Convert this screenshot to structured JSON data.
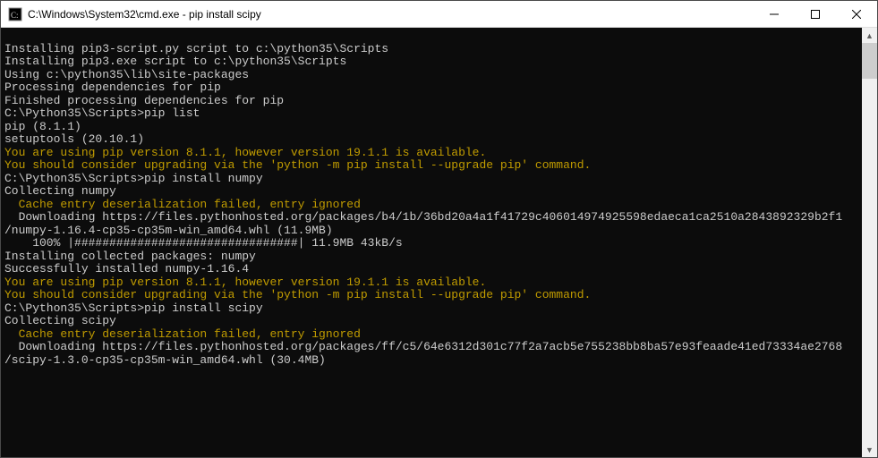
{
  "window": {
    "title": "C:\\Windows\\System32\\cmd.exe - pip  install scipy"
  },
  "lines": {
    "l1": "Installing pip3-script.py script to c:\\python35\\Scripts",
    "l2": "Installing pip3.exe script to c:\\python35\\Scripts",
    "l3": "",
    "l4": "Using c:\\python35\\lib\\site-packages",
    "l5": "Processing dependencies for pip",
    "l6": "Finished processing dependencies for pip",
    "l7": "",
    "l8_prompt": "C:\\Python35\\Scripts>",
    "l8_cmd": "pip list",
    "l9": "pip (8.1.1)",
    "l10": "setuptools (20.10.1)",
    "l11": "You are using pip version 8.1.1, however version 19.1.1 is available.",
    "l12": "You should consider upgrading via the 'python -m pip install --upgrade pip' command.",
    "l13": "",
    "l14_prompt": "C:\\Python35\\Scripts>",
    "l14_cmd": "pip install numpy",
    "l15": "Collecting numpy",
    "l16": "  Cache entry deserialization failed, entry ignored",
    "l17": "  Downloading https://files.pythonhosted.org/packages/b4/1b/36bd20a4a1f41729c406014974925598edaeca1ca2510a2843892329b2f1",
    "l18": "/numpy-1.16.4-cp35-cp35m-win_amd64.whl (11.9MB)",
    "l19": "    100% |################################| 11.9MB 43kB/s",
    "l20": "Installing collected packages: numpy",
    "l21": "Successfully installed numpy-1.16.4",
    "l22": "You are using pip version 8.1.1, however version 19.1.1 is available.",
    "l23": "You should consider upgrading via the 'python -m pip install --upgrade pip' command.",
    "l24": "",
    "l25_prompt": "C:\\Python35\\Scripts>",
    "l25_cmd": "pip install scipy",
    "l26": "Collecting scipy",
    "l27": "  Cache entry deserialization failed, entry ignored",
    "l28": "  Downloading https://files.pythonhosted.org/packages/ff/c5/64e6312d301c77f2a7acb5e755238bb8ba57e93feaade41ed73334ae2768",
    "l29": "/scipy-1.3.0-cp35-cp35m-win_amd64.whl (30.4MB)"
  }
}
